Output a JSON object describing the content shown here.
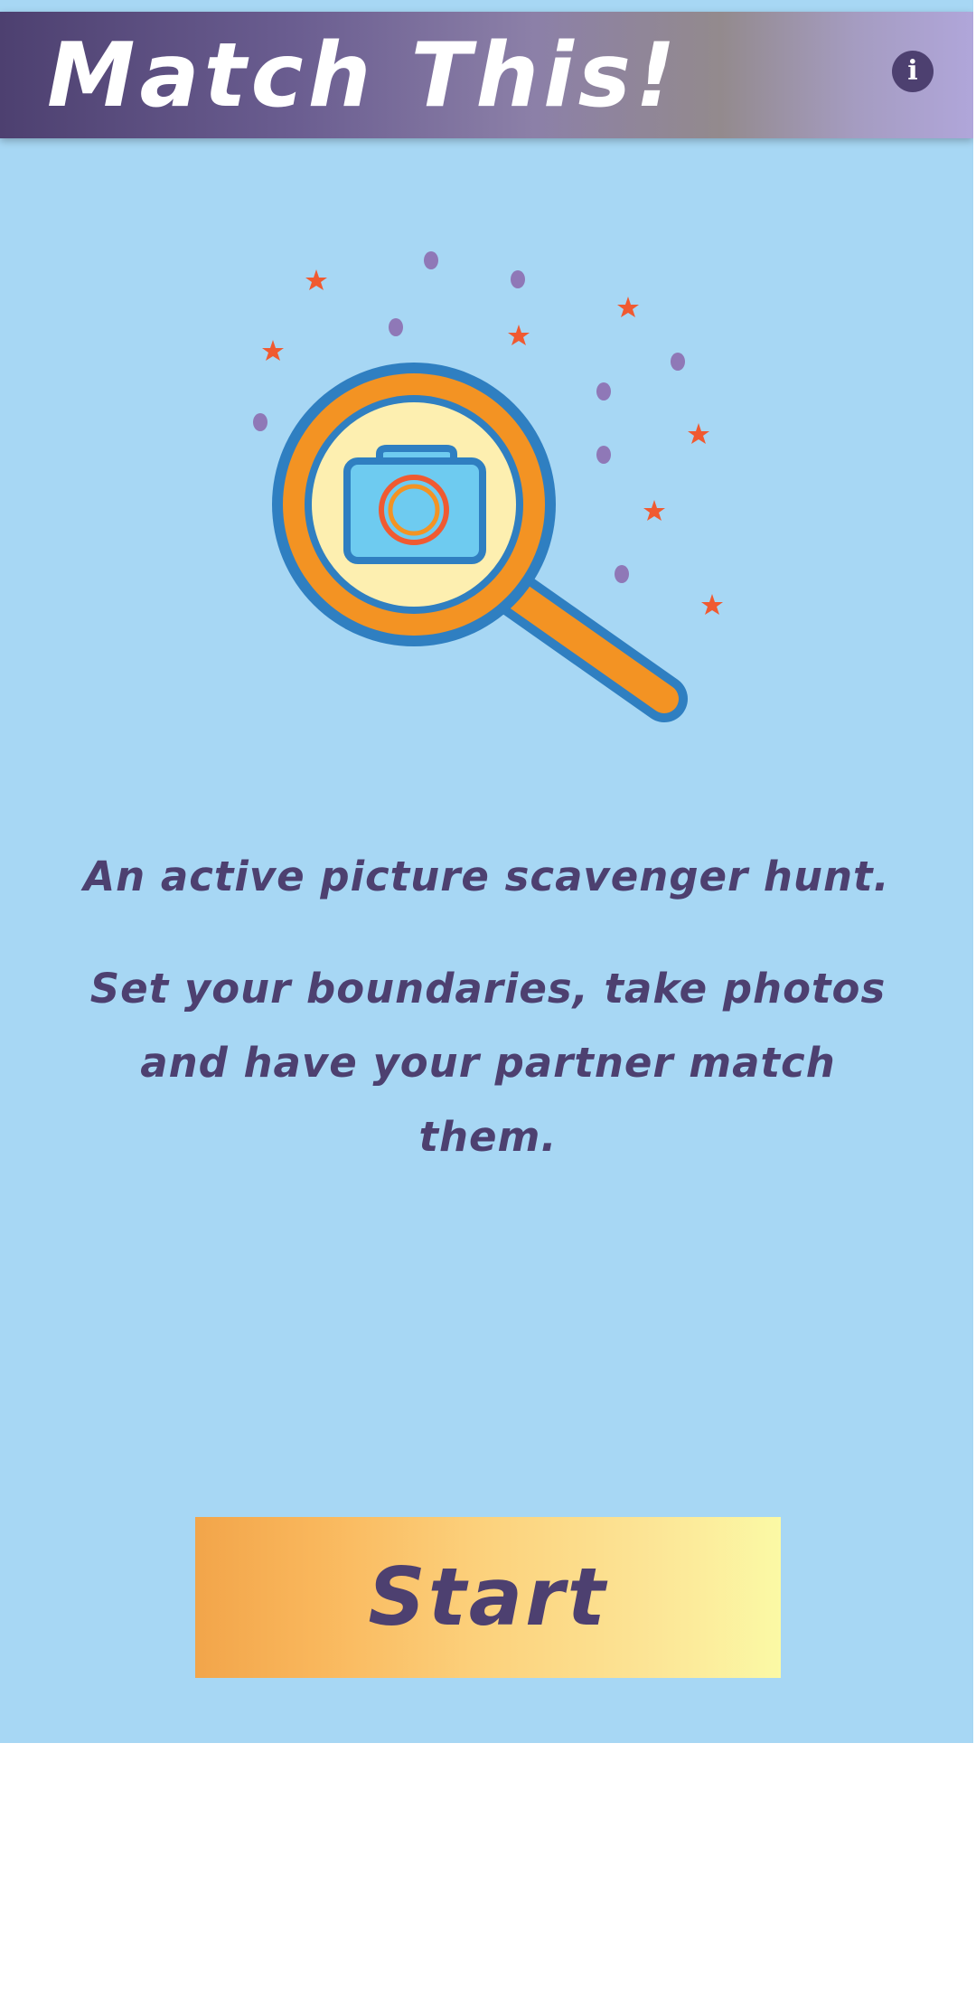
{
  "header": {
    "title": "Match This!",
    "info_icon": "info-icon",
    "info_glyph": "i",
    "background_colors": [
      "#4d4070",
      "#b0a6da"
    ]
  },
  "hero": {
    "illustration": "magnifying-glass-camera-icon",
    "decorations": [
      "star-icon",
      "dot"
    ],
    "colors": {
      "ring_outer": "#2f7fc1",
      "ring_orange": "#f39323",
      "lens": "#fdefb0",
      "camera": "#6ecbf0",
      "star": "#f05a31",
      "dot": "#8f78b7"
    }
  },
  "content": {
    "tagline": "An active picture scavenger hunt.",
    "description": "Set your boundaries, take photos and have your partner match them."
  },
  "start_button": {
    "label": "Start"
  },
  "colors": {
    "background": "#a7d7f4",
    "text": "#4d4070"
  }
}
